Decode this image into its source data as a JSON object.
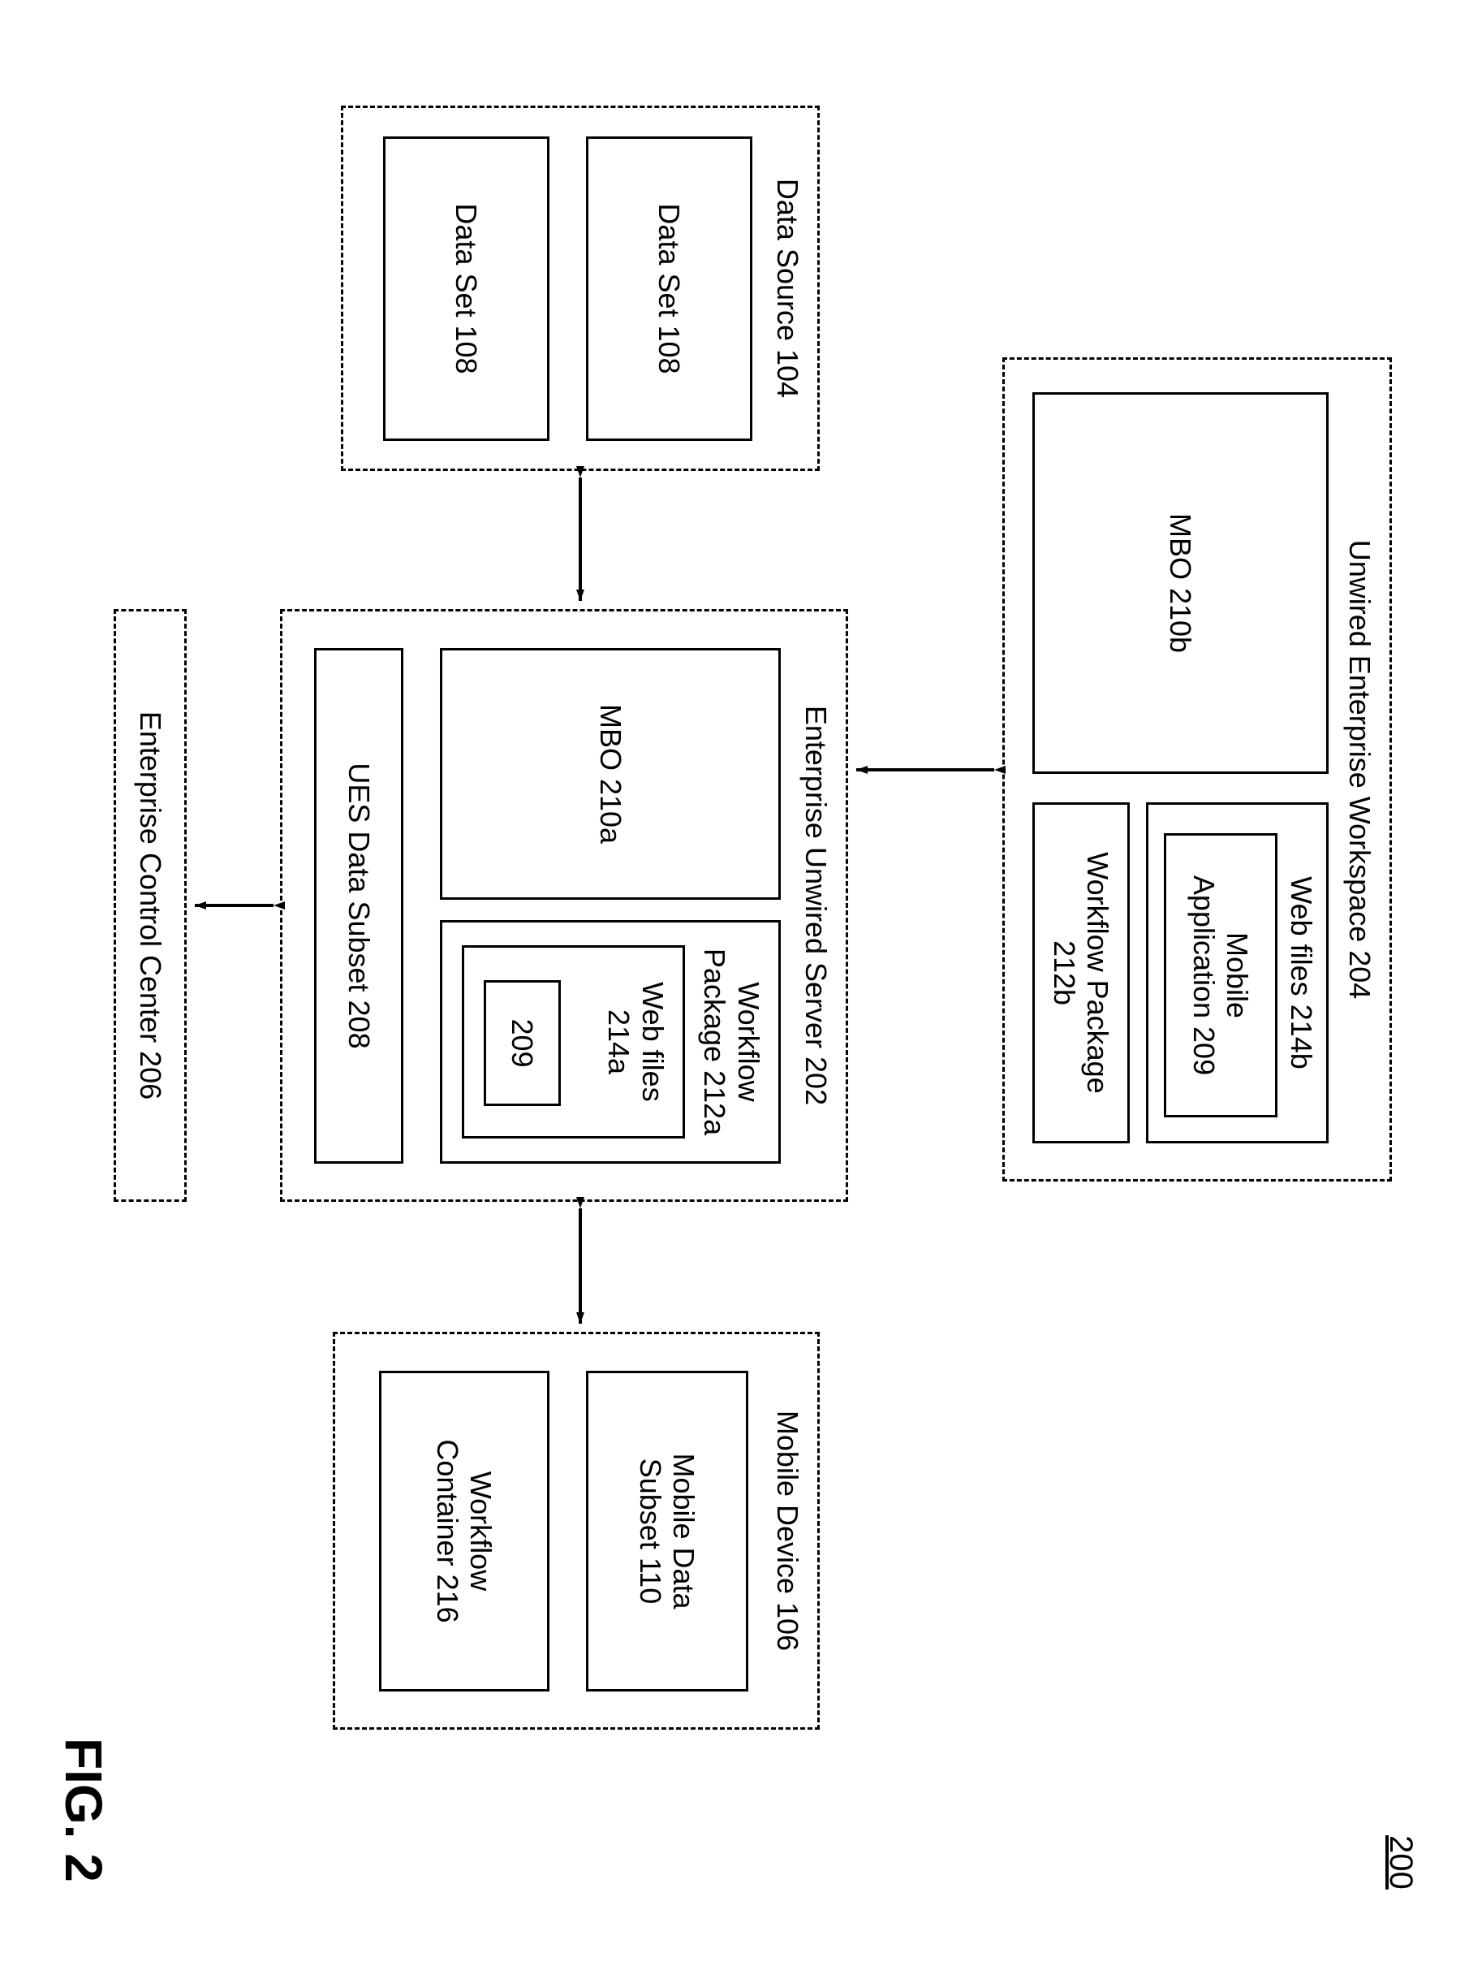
{
  "figure_number": "200",
  "figure_caption": "FIG. 2",
  "uew": {
    "title": "Unwired Enterprise Workspace 204",
    "mbo": "MBO 210b",
    "web_files": "Web files 214b",
    "mobile_app": "Mobile\nApplication 209",
    "workflow_pkg": "Workflow Package\n212b"
  },
  "data_source": {
    "title": "Data Source 104",
    "set1": "Data Set 108",
    "set2": "Data Set 108"
  },
  "eus": {
    "title": "Enterprise Unwired Server 202",
    "mbo": "MBO 210a",
    "workflow_pkg": "Workflow\nPackage 212a",
    "web_files": "Web files\n214a",
    "inner209": "209",
    "ues_subset": "UES Data Subset 208"
  },
  "mobile_device": {
    "title": "Mobile Device 106",
    "subset": "Mobile Data\nSubset 110",
    "container": "Workflow\nContainer 216"
  },
  "ecc": {
    "title": "Enterprise Control Center 206"
  }
}
